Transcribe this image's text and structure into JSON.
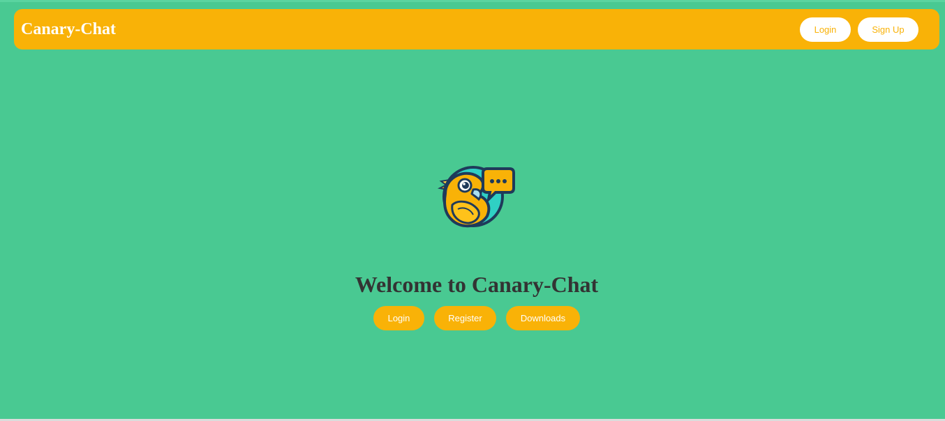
{
  "navbar": {
    "brand": "Canary-Chat",
    "login_label": "Login",
    "signup_label": "Sign Up"
  },
  "hero": {
    "logo_icon": "canary-chat-bird-logo-icon",
    "heading": "Welcome to Canary-Chat",
    "buttons": [
      {
        "label": "Login"
      },
      {
        "label": "Register"
      },
      {
        "label": "Downloads"
      }
    ]
  },
  "colors": {
    "background": "#49c992",
    "accent": "#f9b207",
    "heading_text": "#333333",
    "button_text_light": "#ffffff"
  }
}
